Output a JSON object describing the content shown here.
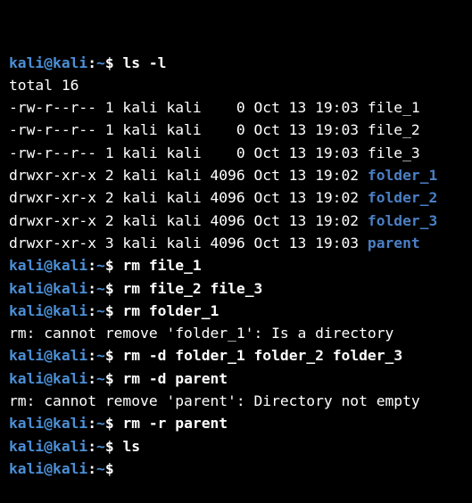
{
  "theme": {
    "background": "#000000",
    "text": "#ffffff",
    "prompt_color": "#4b8fd6",
    "directory_color": "#4b7fc4"
  },
  "prompt": {
    "user_host": "kali@kali",
    "sep": ":",
    "path": "~",
    "symbol": "$"
  },
  "lines": [
    {
      "type": "prompt",
      "cmd": " ls -l"
    },
    {
      "type": "out",
      "text": "total 16"
    },
    {
      "type": "entry",
      "perms": "-rw-r--r-- 1 kali kali    0 Oct 13 19:03 ",
      "name": "file_1",
      "is_dir": false
    },
    {
      "type": "entry",
      "perms": "-rw-r--r-- 1 kali kali    0 Oct 13 19:03 ",
      "name": "file_2",
      "is_dir": false
    },
    {
      "type": "entry",
      "perms": "-rw-r--r-- 1 kali kali    0 Oct 13 19:03 ",
      "name": "file_3",
      "is_dir": false
    },
    {
      "type": "entry",
      "perms": "drwxr-xr-x 2 kali kali 4096 Oct 13 19:02 ",
      "name": "folder_1",
      "is_dir": true
    },
    {
      "type": "entry",
      "perms": "drwxr-xr-x 2 kali kali 4096 Oct 13 19:02 ",
      "name": "folder_2",
      "is_dir": true
    },
    {
      "type": "entry",
      "perms": "drwxr-xr-x 2 kali kali 4096 Oct 13 19:02 ",
      "name": "folder_3",
      "is_dir": true
    },
    {
      "type": "entry",
      "perms": "drwxr-xr-x 3 kali kali 4096 Oct 13 19:03 ",
      "name": "parent",
      "is_dir": true
    },
    {
      "type": "prompt",
      "cmd": " rm file_1"
    },
    {
      "type": "prompt",
      "cmd": " rm file_2 file_3"
    },
    {
      "type": "prompt",
      "cmd": " rm folder_1"
    },
    {
      "type": "out",
      "text": "rm: cannot remove 'folder_1': Is a directory"
    },
    {
      "type": "prompt",
      "cmd": " rm -d folder_1 folder_2 folder_3"
    },
    {
      "type": "prompt",
      "cmd": " rm -d parent"
    },
    {
      "type": "out",
      "text": "rm: cannot remove 'parent': Directory not empty"
    },
    {
      "type": "prompt",
      "cmd": " rm -r parent"
    },
    {
      "type": "prompt",
      "cmd": " ls"
    },
    {
      "type": "prompt",
      "cmd": ""
    }
  ]
}
